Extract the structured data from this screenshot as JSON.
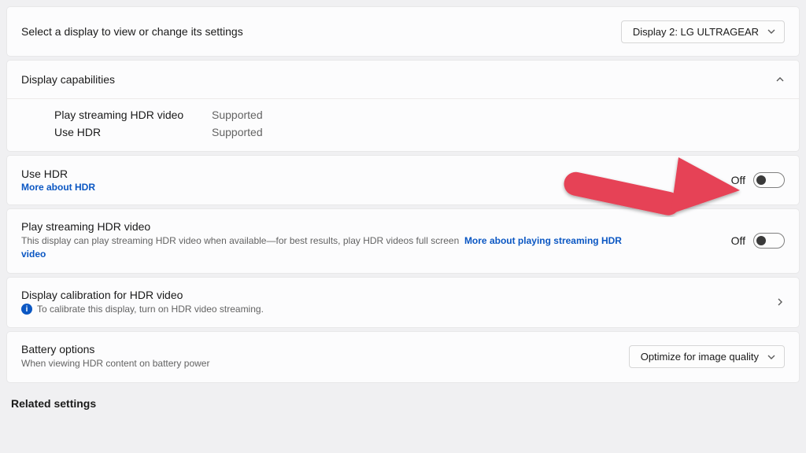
{
  "displaySelect": {
    "prompt": "Select a display to view or change its settings",
    "value": "Display 2: LG ULTRAGEAR"
  },
  "capabilities": {
    "heading": "Display capabilities",
    "rows": [
      {
        "label": "Play streaming HDR video",
        "value": "Supported"
      },
      {
        "label": "Use HDR",
        "value": "Supported"
      }
    ]
  },
  "useHdr": {
    "title": "Use HDR",
    "link": "More about HDR",
    "state": "Off"
  },
  "playStreaming": {
    "title": "Play streaming HDR video",
    "desc": "This display can play streaming HDR video when available—for best results, play HDR videos full screen",
    "link": "More about playing streaming HDR video",
    "state": "Off"
  },
  "calibration": {
    "title": "Display calibration for HDR video",
    "info": "To calibrate this display, turn on HDR video streaming."
  },
  "battery": {
    "title": "Battery options",
    "desc": "When viewing HDR content on battery power",
    "value": "Optimize for image quality"
  },
  "related": {
    "heading": "Related settings"
  }
}
